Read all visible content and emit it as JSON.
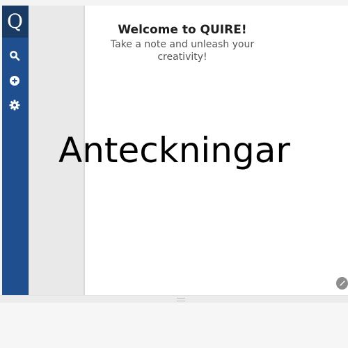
{
  "app": {
    "logo_letter": "Q",
    "brand_color": "#1f4f8f",
    "logo_bg_color": "#193b63"
  },
  "sidebar": {
    "items": [
      {
        "icon": "search-icon"
      },
      {
        "icon": "add-circle-icon"
      },
      {
        "icon": "gear-icon"
      }
    ]
  },
  "editor": {
    "welcome_title": "Welcome to QUIRE!",
    "welcome_subtitle": "Take a note and unleash your creativity!",
    "edit_button_icon": "pencil-icon"
  },
  "overlay": {
    "word": "Anteckningar"
  }
}
